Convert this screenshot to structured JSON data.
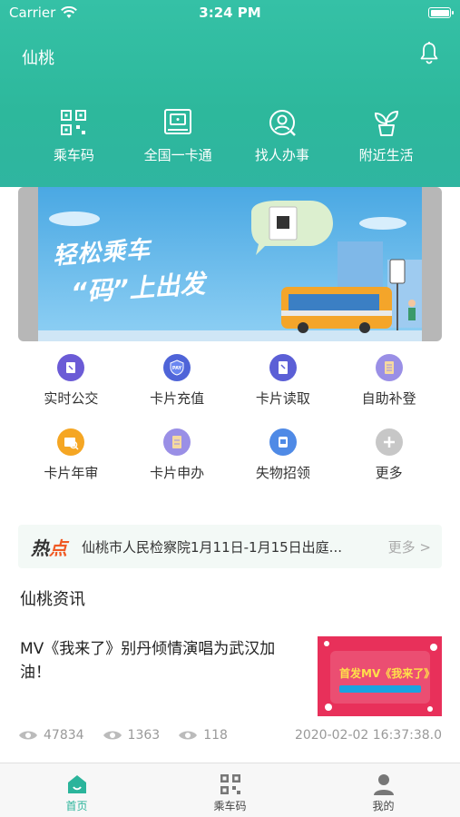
{
  "status_bar": {
    "carrier": "Carrier",
    "time": "3:24 PM",
    "battery_level": 1.0
  },
  "header": {
    "city": "仙桃",
    "bell_icon": "bell-icon"
  },
  "quick_actions": [
    {
      "label": "乘车码",
      "icon": "qr-code-icon"
    },
    {
      "label": "全国一卡通",
      "icon": "card-reader-icon"
    },
    {
      "label": "找人办事",
      "icon": "find-person-icon"
    },
    {
      "label": "附近生活",
      "icon": "plant-icon"
    }
  ],
  "banner": {
    "line1": "轻松乘车",
    "line2": "“码”上出发"
  },
  "services": [
    {
      "label": "实时公交",
      "icon": "bus-realtime-icon",
      "color": "#6b5bd6"
    },
    {
      "label": "卡片充值",
      "icon": "pay-shield-icon",
      "color": "#4f64d8"
    },
    {
      "label": "卡片读取",
      "icon": "card-read-icon",
      "color": "#5b5fd6"
    },
    {
      "label": "自助补登",
      "icon": "self-register-icon",
      "color": "#9a8fe6"
    },
    {
      "label": "卡片年审",
      "icon": "annual-check-icon",
      "color": "#f5a623"
    },
    {
      "label": "卡片申办",
      "icon": "card-apply-icon",
      "color": "#9a8fe6"
    },
    {
      "label": "失物招领",
      "icon": "lost-found-icon",
      "color": "#4f8ae6"
    },
    {
      "label": "更多",
      "icon": "plus-icon",
      "color": "#c7c7c7"
    }
  ],
  "hot": {
    "tag_main": "热",
    "tag_dot": "点",
    "text": "仙桃市人民检察院1月11日-1月15日出庭...",
    "more": "更多 >"
  },
  "news_section": {
    "title": "仙桃资讯"
  },
  "news": {
    "title": "MV《我来了》别丹倾情演唱为武汉加油！",
    "image_label": "首发MV《我来了》",
    "views": "47834",
    "likes": "1363",
    "comments": "118",
    "time": "2020-02-02 16:37:38.0"
  },
  "tabbar": [
    {
      "label": "首页",
      "icon": "home-icon",
      "active": true
    },
    {
      "label": "乘车码",
      "icon": "qr-code-icon",
      "active": false
    },
    {
      "label": "我的",
      "icon": "person-icon",
      "active": false
    }
  ],
  "colors": {
    "accent": "#2bb49b",
    "hot_dot": "#f05a24"
  }
}
